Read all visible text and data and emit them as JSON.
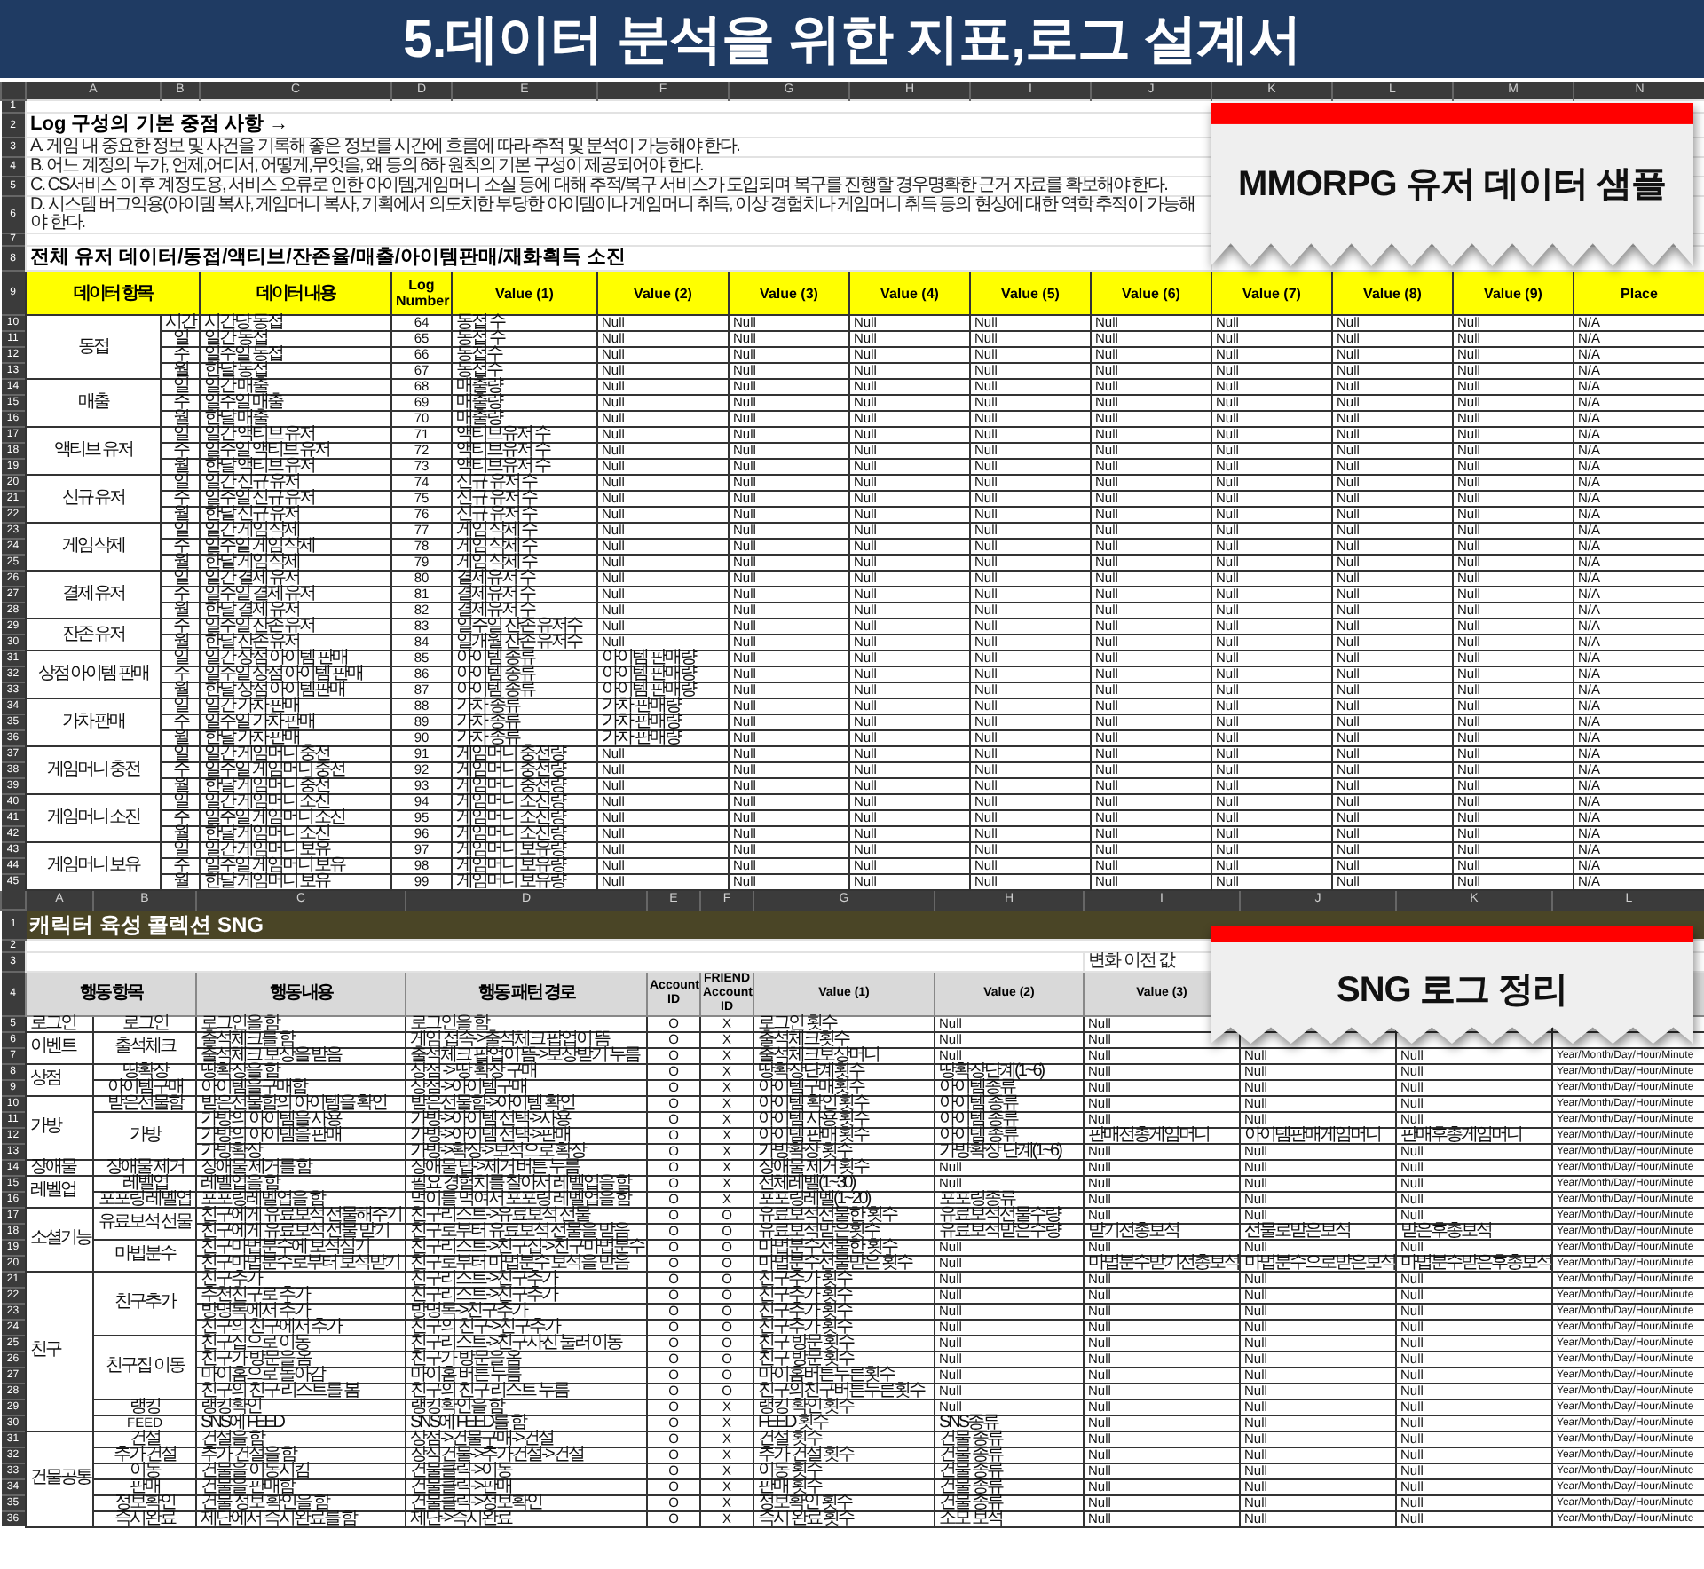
{
  "title": "5.데이터 분석을 위한 지표,로그 설계서",
  "mmorpg_sheet": {
    "callout": "MMORPG 유저 데이터 샘플",
    "column_letters": [
      "A",
      "B",
      "C",
      "D",
      "E",
      "F",
      "G",
      "H",
      "I",
      "J",
      "K",
      "L",
      "M",
      "N"
    ],
    "top_rows": [
      {
        "n": "1",
        "kind": "blank"
      },
      {
        "n": "2",
        "kind": "heading",
        "text": "Log 구성의 기본 중점 사항 →"
      },
      {
        "n": "3",
        "kind": "note",
        "text": "A. 게임 내 중요한 정보 및 사건을 기록해 좋은 정보를 시간에 흐름에 따라 추적 및 분석이 가능해야 한다."
      },
      {
        "n": "4",
        "kind": "note",
        "text": "B. 어느 계정의 누가, 언제,어디서, 어떻게,무엇을, 왜 등의 6하 원칙의 기본 구성이 제공되어야 한다."
      },
      {
        "n": "5",
        "kind": "note",
        "text": "C. CS서비스 이 후 계정도용, 서비스 오류로 인한 아이템,게임머니 소실 등에 대해 추적/복구 서비스가 도입되며 복구를 진행할 경우명확한 근거 자료를 확보해야 한다."
      },
      {
        "n": "6",
        "kind": "note",
        "text": "D. 시스템 버그악용(아이템 복사, 게임머니 복사, 기획에서 의도치한 부당한 아이템이나 게임머니 취득, 이상 경험치나 게임머니 취득 등의 현상에 대한 역학 추적이 가능해야 한다."
      },
      {
        "n": "7",
        "kind": "blank"
      },
      {
        "n": "8",
        "kind": "heading",
        "text": "전체 유저 데이터/동접/액티브/잔존율/매출/아이템판매/재화획득 소진"
      }
    ],
    "header": {
      "n": "9",
      "cells": [
        "데이터 항목",
        "데이터 내용",
        "Log Number",
        "Value (1)",
        "Value (2)",
        "Value (3)",
        "Value (4)",
        "Value (5)",
        "Value (6)",
        "Value (7)",
        "Value (8)",
        "Value (9)",
        "Place"
      ]
    },
    "groups": [
      {
        "label": "동접",
        "rows": [
          [
            "10",
            "시간",
            "시간당 동접",
            "64",
            "동접 수",
            "Null",
            "Null",
            "Null",
            "Null",
            "Null",
            "Null",
            "Null",
            "Null",
            "N/A"
          ],
          [
            "11",
            "일",
            "일간 동접",
            "65",
            "동접 수",
            "Null",
            "Null",
            "Null",
            "Null",
            "Null",
            "Null",
            "Null",
            "Null",
            "N/A"
          ],
          [
            "12",
            "주",
            "일주일 동접",
            "66",
            "동접수",
            "Null",
            "Null",
            "Null",
            "Null",
            "Null",
            "Null",
            "Null",
            "Null",
            "N/A"
          ],
          [
            "13",
            "월",
            "한달 동접",
            "67",
            "동접수",
            "Null",
            "Null",
            "Null",
            "Null",
            "Null",
            "Null",
            "Null",
            "Null",
            "N/A"
          ]
        ]
      },
      {
        "label": "매출",
        "rows": [
          [
            "14",
            "일",
            "일간 매출",
            "68",
            "매출량",
            "Null",
            "Null",
            "Null",
            "Null",
            "Null",
            "Null",
            "Null",
            "Null",
            "N/A"
          ],
          [
            "15",
            "주",
            "일주일 매출",
            "69",
            "매출량",
            "Null",
            "Null",
            "Null",
            "Null",
            "Null",
            "Null",
            "Null",
            "Null",
            "N/A"
          ],
          [
            "16",
            "월",
            "한달 매출",
            "70",
            "매출량",
            "Null",
            "Null",
            "Null",
            "Null",
            "Null",
            "Null",
            "Null",
            "Null",
            "N/A"
          ]
        ]
      },
      {
        "label": "액티브 유저",
        "rows": [
          [
            "17",
            "일",
            "일간 액티브 유저",
            "71",
            "액티브유저 수",
            "Null",
            "Null",
            "Null",
            "Null",
            "Null",
            "Null",
            "Null",
            "Null",
            "N/A"
          ],
          [
            "18",
            "주",
            "일주일 액티브 유저",
            "72",
            "액티브유저 수",
            "Null",
            "Null",
            "Null",
            "Null",
            "Null",
            "Null",
            "Null",
            "Null",
            "N/A"
          ],
          [
            "19",
            "월",
            "한달 액티브 유저",
            "73",
            "액티브유저 수",
            "Null",
            "Null",
            "Null",
            "Null",
            "Null",
            "Null",
            "Null",
            "Null",
            "N/A"
          ]
        ]
      },
      {
        "label": "신규 유저",
        "rows": [
          [
            "20",
            "일",
            "일간 신규 유저",
            "74",
            "신규 유저 수",
            "Null",
            "Null",
            "Null",
            "Null",
            "Null",
            "Null",
            "Null",
            "Null",
            "N/A"
          ],
          [
            "21",
            "주",
            "일주일 신규 유저",
            "75",
            "신규 유저 수",
            "Null",
            "Null",
            "Null",
            "Null",
            "Null",
            "Null",
            "Null",
            "Null",
            "N/A"
          ],
          [
            "22",
            "월",
            "한달 신규 유저",
            "76",
            "신규 유저 수",
            "Null",
            "Null",
            "Null",
            "Null",
            "Null",
            "Null",
            "Null",
            "Null",
            "N/A"
          ]
        ]
      },
      {
        "label": "게임 삭제",
        "rows": [
          [
            "23",
            "일",
            "일간 게임 삭제",
            "77",
            "게임 삭제 수",
            "Null",
            "Null",
            "Null",
            "Null",
            "Null",
            "Null",
            "Null",
            "Null",
            "N/A"
          ],
          [
            "24",
            "주",
            "일주일 게임 삭제",
            "78",
            "게임 삭제 수",
            "Null",
            "Null",
            "Null",
            "Null",
            "Null",
            "Null",
            "Null",
            "Null",
            "N/A"
          ],
          [
            "25",
            "월",
            "한달 게임 삭제",
            "79",
            "게임 삭제 수",
            "Null",
            "Null",
            "Null",
            "Null",
            "Null",
            "Null",
            "Null",
            "Null",
            "N/A"
          ]
        ]
      },
      {
        "label": "결제 유저",
        "rows": [
          [
            "26",
            "일",
            "일간 결제 유저",
            "80",
            "결제유저 수",
            "Null",
            "Null",
            "Null",
            "Null",
            "Null",
            "Null",
            "Null",
            "Null",
            "N/A"
          ],
          [
            "27",
            "주",
            "일주일 결제 유저",
            "81",
            "결제유저 수",
            "Null",
            "Null",
            "Null",
            "Null",
            "Null",
            "Null",
            "Null",
            "Null",
            "N/A"
          ],
          [
            "28",
            "월",
            "한달 결제 유저",
            "82",
            "결제유저 수",
            "Null",
            "Null",
            "Null",
            "Null",
            "Null",
            "Null",
            "Null",
            "Null",
            "N/A"
          ]
        ]
      },
      {
        "label": "잔존 유저",
        "rows": [
          [
            "29",
            "주",
            "일주일 잔존 유저",
            "83",
            "일주일 잔존 유저수",
            "Null",
            "Null",
            "Null",
            "Null",
            "Null",
            "Null",
            "Null",
            "Null",
            "N/A"
          ],
          [
            "30",
            "월",
            "한달 잔존 유저",
            "84",
            "일개월 잔존 유저수",
            "Null",
            "Null",
            "Null",
            "Null",
            "Null",
            "Null",
            "Null",
            "Null",
            "N/A"
          ]
        ]
      },
      {
        "label": "상점 아이템 판매",
        "rows": [
          [
            "31",
            "일",
            "일간 상점 아이템 판매",
            "85",
            "아이템 종류",
            "아이템 판매량",
            "Null",
            "Null",
            "Null",
            "Null",
            "Null",
            "Null",
            "Null",
            "N/A"
          ],
          [
            "32",
            "주",
            "일주일 상점 아이템 판매",
            "86",
            "아이템 종류",
            "아이템 판매량",
            "Null",
            "Null",
            "Null",
            "Null",
            "Null",
            "Null",
            "Null",
            "N/A"
          ],
          [
            "33",
            "월",
            "한달 상점 아이템판매",
            "87",
            "아이템 종류",
            "아이템 판매량",
            "Null",
            "Null",
            "Null",
            "Null",
            "Null",
            "Null",
            "Null",
            "N/A"
          ]
        ]
      },
      {
        "label": "가차 판매",
        "rows": [
          [
            "34",
            "일",
            "일간 가차 판매",
            "88",
            "가차 종류",
            "가차 판매량",
            "Null",
            "Null",
            "Null",
            "Null",
            "Null",
            "Null",
            "Null",
            "N/A"
          ],
          [
            "35",
            "주",
            "일주일 가차 판매",
            "89",
            "가차 종류",
            "가차 판매량",
            "Null",
            "Null",
            "Null",
            "Null",
            "Null",
            "Null",
            "Null",
            "N/A"
          ],
          [
            "36",
            "월",
            "한달 가차 판매",
            "90",
            "가차 종류",
            "가차 판매량",
            "Null",
            "Null",
            "Null",
            "Null",
            "Null",
            "Null",
            "Null",
            "N/A"
          ]
        ]
      },
      {
        "label": "게임머니 충전",
        "rows": [
          [
            "37",
            "일",
            "일간 게임머니 충전",
            "91",
            "게임머니 충전량",
            "Null",
            "Null",
            "Null",
            "Null",
            "Null",
            "Null",
            "Null",
            "Null",
            "N/A"
          ],
          [
            "38",
            "주",
            "일주일 게임머니 충전",
            "92",
            "게임머니 충전량",
            "Null",
            "Null",
            "Null",
            "Null",
            "Null",
            "Null",
            "Null",
            "Null",
            "N/A"
          ],
          [
            "39",
            "월",
            "한달 게임머니 충전",
            "93",
            "게임머니 충전량",
            "Null",
            "Null",
            "Null",
            "Null",
            "Null",
            "Null",
            "Null",
            "Null",
            "N/A"
          ]
        ]
      },
      {
        "label": "게임머니 소진",
        "rows": [
          [
            "40",
            "일",
            "일간 게임머니 소진",
            "94",
            "게임머니 소진량",
            "Null",
            "Null",
            "Null",
            "Null",
            "Null",
            "Null",
            "Null",
            "Null",
            "N/A"
          ],
          [
            "41",
            "주",
            "일주일 게임머니 소진",
            "95",
            "게임머니 소진량",
            "Null",
            "Null",
            "Null",
            "Null",
            "Null",
            "Null",
            "Null",
            "Null",
            "N/A"
          ],
          [
            "42",
            "월",
            "한달 게임머니 소진",
            "96",
            "게임머니 소진량",
            "Null",
            "Null",
            "Null",
            "Null",
            "Null",
            "Null",
            "Null",
            "Null",
            "N/A"
          ]
        ]
      },
      {
        "label": "게임머니 보유",
        "rows": [
          [
            "43",
            "일",
            "일간 게임머니 보유",
            "97",
            "게임머니 보유량",
            "Null",
            "Null",
            "Null",
            "Null",
            "Null",
            "Null",
            "Null",
            "Null",
            "N/A"
          ],
          [
            "44",
            "주",
            "일주일 게임머니 보유",
            "98",
            "게임머니 보유량",
            "Null",
            "Null",
            "Null",
            "Null",
            "Null",
            "Null",
            "Null",
            "Null",
            "N/A"
          ],
          [
            "45",
            "월",
            "한달 게임머니 보유",
            "99",
            "게임머니 보유량",
            "Null",
            "Null",
            "Null",
            "Null",
            "Null",
            "Null",
            "Null",
            "Null",
            "N/A"
          ]
        ]
      }
    ]
  },
  "sng_sheet": {
    "callout": "SNG 로그 정리",
    "column_letters": [
      "A",
      "B",
      "C",
      "D",
      "E",
      "F",
      "G",
      "H",
      "I",
      "J",
      "K",
      "L"
    ],
    "top_rows": [
      {
        "n": "1",
        "kind": "title",
        "text": "캐릭터 육성 콜렉션 SNG"
      },
      {
        "n": "2",
        "kind": "blank"
      },
      {
        "n": "3",
        "kind": "note",
        "text": "변화 이전 값"
      }
    ],
    "header": {
      "n": "4",
      "cells": [
        "행동 항목",
        "행동 내용",
        "행동 패턴 경로",
        "Account ID",
        "FRIEND Account ID",
        "Value (1)",
        "Value (2)",
        "Value (3)"
      ]
    },
    "groups": [
      {
        "label": "로그인",
        "subs": [
          {
            "label": "로그인",
            "rows": [
              [
                "5",
                "로그인을 함",
                "로그인을 함",
                "O",
                "X",
                "로그인 횟수",
                "Null",
                "Null",
                null,
                null,
                null
              ]
            ]
          }
        ]
      },
      {
        "label": "이벤트",
        "subs": [
          {
            "label": "출석체크",
            "rows": [
              [
                "6",
                "출석체크를 함",
                "게임 접속->출석체크 팝업이 뜸",
                "O",
                "X",
                "출석체크횟수",
                "Null",
                "Null",
                null,
                null,
                null
              ],
              [
                "7",
                "출석체크 보상을 받음",
                "출석체크 팝업이 뜸->보상받기 누름",
                "O",
                "X",
                "출석체크보상머니",
                "Null",
                "Null",
                "Null",
                "Null",
                "Year/Month/Day/Hour/Minute"
              ]
            ]
          }
        ]
      },
      {
        "label": "상점",
        "subs": [
          {
            "label": "땅확장",
            "rows": [
              [
                "8",
                "땅확장을 함",
                "상점 -> 땅 확장 구매",
                "O",
                "X",
                "땅확장단계횟수",
                "땅확장단계(1~6)",
                "Null",
                "Null",
                "Null",
                "Year/Month/Day/Hour/Minute"
              ]
            ]
          },
          {
            "label": "아이템구매",
            "rows": [
              [
                "9",
                "아이템을구매함",
                "상점->아이템구매",
                "O",
                "X",
                "아이템구매횟수",
                "아이템종류",
                "Null",
                "Null",
                "Null",
                "Year/Month/Day/Hour/Minute"
              ]
            ]
          }
        ]
      },
      {
        "label": "가방",
        "subs": [
          {
            "label": "받은선물함",
            "rows": [
              [
                "10",
                "받은선물함의 아이템을 확인",
                "받은선물함->아이템 확인",
                "O",
                "X",
                "아이템 확인 횟수",
                "아이템 종류",
                "Null",
                "Null",
                "Null",
                "Year/Month/Day/Hour/Minute"
              ]
            ]
          },
          {
            "label": "가방",
            "rows": [
              [
                "11",
                "가방의 아이템을 사용",
                "가방->아이템 선택->사용",
                "O",
                "X",
                "아이템 사용 횟수",
                "아이템 종류",
                "Null",
                "Null",
                "Null",
                "Year/Month/Day/Hour/Minute"
              ],
              [
                "12",
                "가방의 아이템을 판매",
                "가방->아이템 선택->판매",
                "O",
                "X",
                "아이템 판매 횟수",
                "아이템 종류",
                "판매전총게임머니",
                "아이템판매게임머니",
                "판매후총게임머니",
                "Year/Month/Day/Hour/Minute"
              ],
              [
                "13",
                "가방확장",
                "가방->확장->보석으로 확장",
                "O",
                "X",
                "가방확장 횟수",
                "가방확장 단계(1~6)",
                "Null",
                "Null",
                "Null",
                "Year/Month/Day/Hour/Minute"
              ]
            ]
          }
        ]
      },
      {
        "label": "장애물",
        "subs": [
          {
            "label": "장애물 제거",
            "rows": [
              [
                "14",
                "장애물 제거를 함",
                "장애물 탭->제거 버튼 누름",
                "O",
                "X",
                "장애물 제거 횟수",
                "Null",
                "Null",
                "Null",
                "Null",
                "Year/Month/Day/Hour/Minute"
              ]
            ]
          }
        ]
      },
      {
        "label": "레벨업",
        "subs": [
          {
            "label": "레벨업",
            "rows": [
              [
                "15",
                "레벨업을 함",
                "필요 경험치를 찰아서 레벨업을 함",
                "O",
                "X",
                "전체레벨(1~30)",
                "Null",
                "Null",
                "Null",
                "Null",
                "Year/Month/Day/Hour/Minute"
              ]
            ]
          },
          {
            "label": "포포링 레벨업",
            "rows": [
              [
                "16",
                "포포링레벨업을 함",
                "먹이를 먹여서 포포링 레벨업을 함",
                "O",
                "X",
                "포포링레벨(1~20)",
                "포포링종류",
                "Null",
                "Null",
                "Null",
                "Year/Month/Day/Hour/Minute"
              ]
            ]
          }
        ]
      },
      {
        "label": "소셜기능",
        "subs": [
          {
            "label": "유료보석 선물",
            "rows": [
              [
                "17",
                "친구에게 유료보석 선물해주기",
                "친구리스트->유료보석 선물",
                "O",
                "O",
                "유료보석선물한 횟수",
                "유료보석선물수량",
                "Null",
                "Null",
                "Null",
                "Year/Month/Day/Hour/Minute"
              ],
              [
                "18",
                "친구에게 유료보석 선물 받기",
                "친구로부터 유료보석 선물을 받음",
                "O",
                "O",
                "유료보석받은횟수",
                "유료보석받은수량",
                "받기전총보석",
                "선물로받은보석",
                "받은후총보석",
                "Year/Month/Day/Hour/Minute"
              ]
            ]
          },
          {
            "label": "마법분수",
            "rows": [
              [
                "19",
                "친구마법분수에 보석심기",
                "친구리스트->친구집->친구마법분수",
                "O",
                "O",
                "마법분수선물한 횟수",
                "Null",
                "Null",
                "Null",
                "Null",
                "Year/Month/Day/Hour/Minute"
              ],
              [
                "20",
                "친구마법분수로부터 보석받기",
                "친구로부터 마법분수 보석을 받음",
                "O",
                "O",
                "마법분수선물받은 횟수",
                "Null",
                "마법분수받기전총보석",
                "마법분수으로받은보석",
                "마법분수받은후총보석",
                "Year/Month/Day/Hour/Minute"
              ]
            ]
          }
        ]
      },
      {
        "label": "친구",
        "subs": [
          {
            "label": "친구추가",
            "rows": [
              [
                "21",
                "친구추가",
                "친구리스트->친구추가",
                "O",
                "O",
                "친구추가 횟수",
                "Null",
                "Null",
                "Null",
                "Null",
                "Year/Month/Day/Hour/Minute"
              ],
              [
                "22",
                "추천친구로 추가",
                "친구리스트->친구추가",
                "O",
                "O",
                "친구추가 횟수",
                "Null",
                "Null",
                "Null",
                "Null",
                "Year/Month/Day/Hour/Minute"
              ],
              [
                "23",
                "방명록에서 추가",
                "방명록->친구추가",
                "O",
                "O",
                "친구추가 횟수",
                "Null",
                "Null",
                "Null",
                "Null",
                "Year/Month/Day/Hour/Minute"
              ],
              [
                "24",
                "친구의 친구에서 추가",
                "친구의 친구->친구추가",
                "O",
                "O",
                "친구추가 횟수",
                "Null",
                "Null",
                "Null",
                "Null",
                "Year/Month/Day/Hour/Minute"
              ]
            ]
          },
          {
            "label": "친구집 이동",
            "rows": [
              [
                "25",
                "친구집으로 이동",
                "친구리스트->친구사진 눌러 이동",
                "O",
                "O",
                "친구 방문 횟수",
                "Null",
                "Null",
                "Null",
                "Null",
                "Year/Month/Day/Hour/Minute"
              ],
              [
                "26",
                "친구가 방문을 옴",
                "친구가 방문을 옴",
                "O",
                "O",
                "친구 방문 횟수",
                "Null",
                "Null",
                "Null",
                "Null",
                "Year/Month/Day/Hour/Minute"
              ],
              [
                "27",
                "마이홈으로 돌아감",
                "마이홈 버튼 누름",
                "O",
                "O",
                "마이홈버튼누른횟수",
                "Null",
                "Null",
                "Null",
                "Null",
                "Year/Month/Day/Hour/Minute"
              ],
              [
                "28",
                "친구의 친구 리스트를 봄",
                "친구의 친구 리스트 누름",
                "O",
                "O",
                "친구의친구버튼누른횟수",
                "Null",
                "Null",
                "Null",
                "Null",
                "Year/Month/Day/Hour/Minute"
              ]
            ]
          },
          {
            "label": "랭킹",
            "rows": [
              [
                "29",
                "랭킹확인",
                "랭킹확인을 함",
                "O",
                "X",
                "랭킹 확인 횟수",
                "Null",
                "Null",
                "Null",
                "Null",
                "Year/Month/Day/Hour/Minute"
              ]
            ]
          },
          {
            "label": "FEED",
            "rows": [
              [
                "30",
                "SNS에 FEED",
                "SNS에 FEED를 함",
                "O",
                "X",
                "FEED 횟수",
                "SNS종류",
                "Null",
                "Null",
                "Null",
                "Year/Month/Day/Hour/Minute"
              ]
            ]
          }
        ]
      },
      {
        "label": "건물공통",
        "subs": [
          {
            "label": "건설",
            "rows": [
              [
                "31",
                "건설을 함",
                "상점->건물구매->건설",
                "O",
                "X",
                "건설 횟수",
                "건물 종류",
                "Null",
                "Null",
                "Null",
                "Year/Month/Day/Hour/Minute"
              ]
            ]
          },
          {
            "label": "추가 건설",
            "rows": [
              [
                "32",
                "추가 건설을 함",
                "장식건물->추가건설->건설",
                "O",
                "X",
                "추가 건설 횟수",
                "건물 종류",
                "Null",
                "Null",
                "Null",
                "Year/Month/Day/Hour/Minute"
              ]
            ]
          },
          {
            "label": "이동",
            "rows": [
              [
                "33",
                "건물을 이동시킴",
                "건물클릭->이동",
                "O",
                "X",
                "이동 횟수",
                "건물 종류",
                "Null",
                "Null",
                "Null",
                "Year/Month/Day/Hour/Minute"
              ]
            ]
          },
          {
            "label": "판매",
            "rows": [
              [
                "34",
                "건물을 판매함",
                "건물클릭->판매",
                "O",
                "X",
                "판매 횟수",
                "건물 종류",
                "Null",
                "Null",
                "Null",
                "Year/Month/Day/Hour/Minute"
              ]
            ]
          },
          {
            "label": "정보확인",
            "rows": [
              [
                "35",
                "건물 정보 확인을 함",
                "건물클릭->정보확인",
                "O",
                "X",
                "정보확인 횟수",
                "건물 종류",
                "Null",
                "Null",
                "Null",
                "Year/Month/Day/Hour/Minute"
              ]
            ]
          },
          {
            "label": "즉시완료",
            "rows": [
              [
                "36",
                "제단에서 즉시완료를 함",
                "제단->즉시완료",
                "O",
                "X",
                "즉시 완료 횟수",
                "소모 보석",
                "Null",
                "Null",
                "Null",
                "Year/Month/Day/Hour/Minute"
              ]
            ]
          }
        ]
      }
    ]
  }
}
